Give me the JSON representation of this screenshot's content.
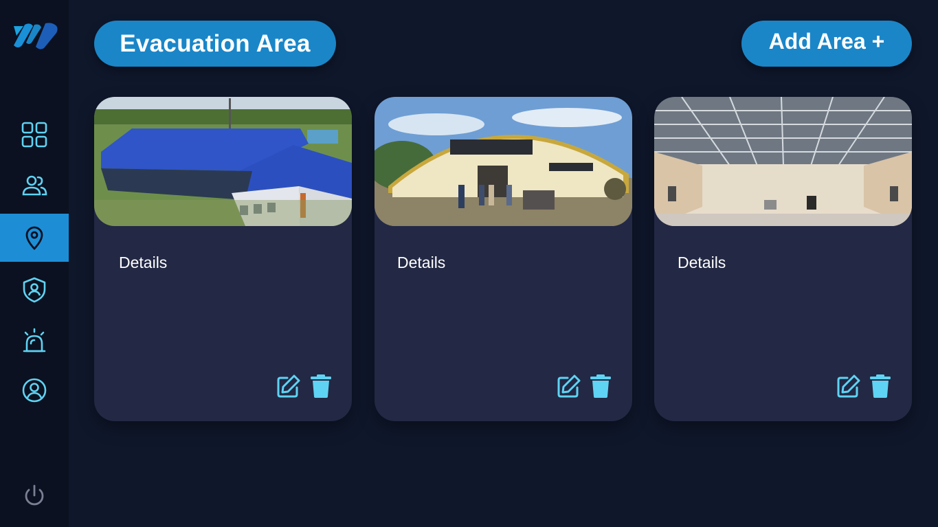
{
  "header": {
    "title": "Evacuation Area",
    "add_button_label": "Add Area +"
  },
  "sidebar": {
    "logo": "brand-logo-icon",
    "items": [
      {
        "icon": "dashboard-grid-icon",
        "active": false
      },
      {
        "icon": "users-icon",
        "active": false
      },
      {
        "icon": "location-pin-icon",
        "active": true
      },
      {
        "icon": "shield-user-icon",
        "active": false
      },
      {
        "icon": "siren-alarm-icon",
        "active": false
      },
      {
        "icon": "profile-icon",
        "active": false
      }
    ],
    "footer_icon": "power-icon"
  },
  "areas": [
    {
      "details_label": "Details",
      "image": "building with blue roof"
    },
    {
      "details_label": "Details",
      "image": "arched-roof hall"
    },
    {
      "details_label": "Details",
      "image": "interior of empty warehouse hall"
    }
  ],
  "colors": {
    "background": "#0f172b",
    "sidebar": "#0b1120",
    "accent": "#1a86c8",
    "card": "#232844",
    "icon": "#5fd3f3"
  }
}
